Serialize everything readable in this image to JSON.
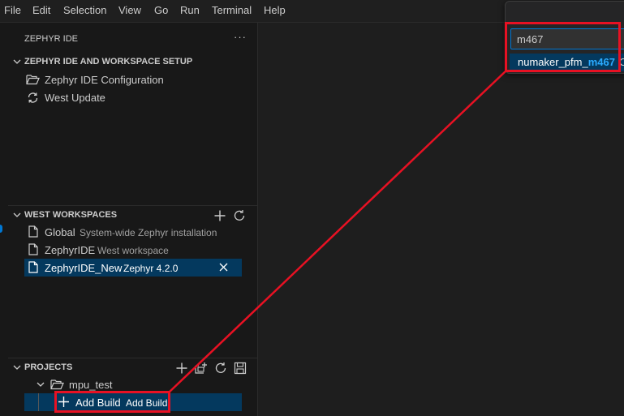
{
  "menu": [
    "File",
    "Edit",
    "Selection",
    "View",
    "Go",
    "Run",
    "Terminal",
    "Help"
  ],
  "sidebar": {
    "title": "ZEPHYR IDE",
    "more_label": "···",
    "setup": {
      "title": "ZEPHYR IDE AND WORKSPACE SETUP",
      "items": [
        {
          "label": "Zephyr IDE Configuration",
          "icon": "folder-open-icon"
        },
        {
          "label": "West Update",
          "icon": "refresh-icon"
        }
      ]
    },
    "west": {
      "title": "WEST WORKSPACES",
      "items": [
        {
          "label": "Global",
          "desc": "System-wide Zephyr installation",
          "icon": "file-icon"
        },
        {
          "label": "ZephyrIDE",
          "desc": "West workspace",
          "icon": "file-icon"
        },
        {
          "label": "ZephyrIDE_New",
          "desc": "Zephyr 4.2.0",
          "icon": "file-icon",
          "selected": true
        }
      ]
    },
    "projects": {
      "title": "PROJECTS",
      "project": {
        "label": "mpu_test"
      },
      "add_build": {
        "label": "Add Build",
        "desc": "Add Build"
      }
    }
  },
  "quickpick": {
    "input_value": "m467",
    "result_prefix": "numaker_pfm_",
    "result_match": "m467",
    "result_trail": "C"
  },
  "colors": {
    "accent": "#0078d4",
    "selection": "#04395e",
    "annotation": "#e81123"
  }
}
